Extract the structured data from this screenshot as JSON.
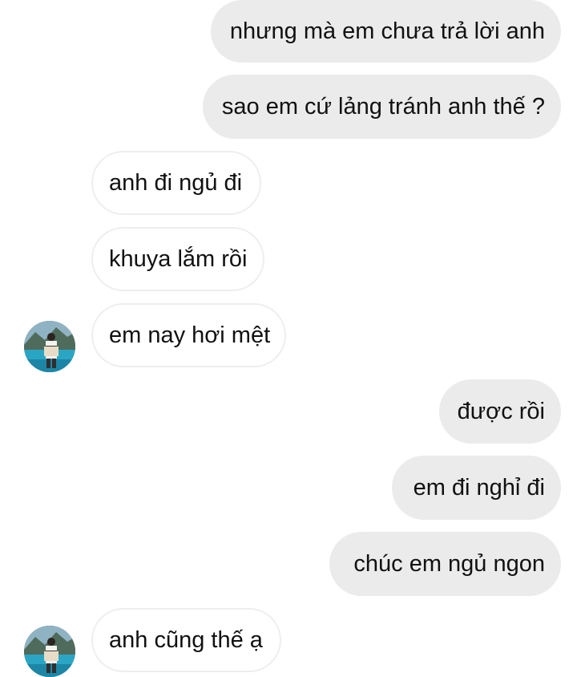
{
  "conversation": {
    "messages": [
      {
        "side": "outgoing",
        "text": "nhưng mà em chưa trả lời anh"
      },
      {
        "side": "outgoing",
        "text": "sao em cứ lảng tránh anh thế ?"
      },
      {
        "side": "incoming",
        "text": "anh đi ngủ đi"
      },
      {
        "side": "incoming",
        "text": "khuya lắm rồi"
      },
      {
        "side": "incoming",
        "text": "em nay hơi mệt"
      },
      {
        "side": "outgoing",
        "text": "được rồi"
      },
      {
        "side": "outgoing",
        "text": "em đi nghỉ đi"
      },
      {
        "side": "outgoing",
        "text": "chúc em ngủ ngon"
      },
      {
        "side": "incoming",
        "text": "anh cũng thế ạ"
      }
    ]
  },
  "colors": {
    "outgoing_bubble": "#ebebeb",
    "incoming_bubble": "#ffffff",
    "incoming_border": "#eeeeee",
    "text": "#111111"
  },
  "icons": {
    "contact_avatar": "avatar-photo-lake"
  }
}
